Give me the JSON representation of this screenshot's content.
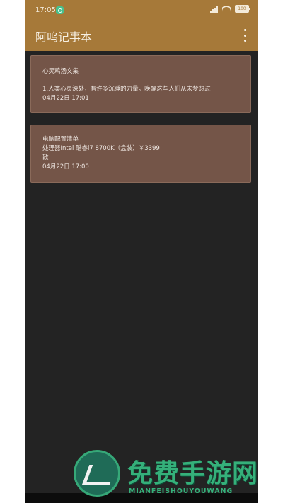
{
  "status_bar": {
    "time": "17:05",
    "battery": "100",
    "icons": [
      "shield-icon",
      "signal-icon",
      "wifi-icon",
      "battery-icon"
    ]
  },
  "app_bar": {
    "title": "阿呜记事本",
    "menu_icon": "more-vert-icon"
  },
  "notes": [
    {
      "title": "心灵鸡汤文集",
      "body": "1.人类心灵深处，有许多沉睡的力量。唤醒这些人们从未梦想过",
      "date": "04月22日 17:01"
    },
    {
      "title": "电脑配置清单",
      "body": "处理器Intel 酷睿i7 8700K（盒装）￥3399",
      "body2": "散",
      "date": "04月22日 17:00"
    }
  ],
  "watermark": {
    "title": "免费手游网",
    "subtitle": "MIANFEISHOUYOUWANG"
  },
  "colors": {
    "accent": "#a67939",
    "background": "#232323",
    "card": "#745548",
    "watermark": "#35b07a"
  }
}
